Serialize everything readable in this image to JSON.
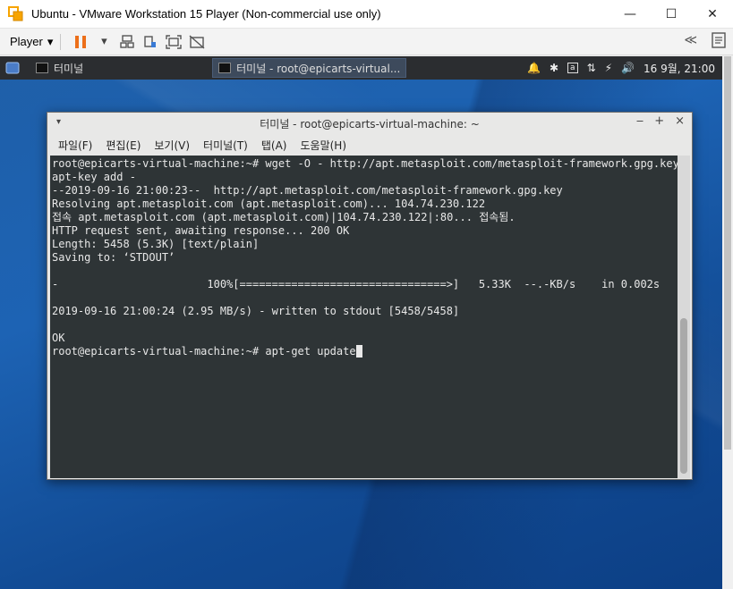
{
  "host": {
    "title": "Ubuntu - VMware Workstation 15 Player (Non-commercial use only)",
    "controls": {
      "minimize": "—",
      "maximize": "☐",
      "close": "✕"
    },
    "toolbar": {
      "player_label": "Player",
      "dropdown_arrow": "▾",
      "collapse_glyph": "≪"
    }
  },
  "guest_panel": {
    "launcher_label": "터미널",
    "active_task_label": "터미널 - root@epicarts-virtual...",
    "tray": {
      "date_time": "16 9월, 21:00"
    }
  },
  "terminal": {
    "title": "터미널 - root@epicarts-virtual-machine: ~",
    "menu": [
      "파일(F)",
      "편집(E)",
      "보기(V)",
      "터미널(T)",
      "탭(A)",
      "도움말(H)"
    ],
    "lines": [
      "root@epicarts-virtual-machine:~# wget -O - http://apt.metasploit.com/metasploit-framework.gpg.key |",
      "apt-key add -",
      "--2019-09-16 21:00:23--  http://apt.metasploit.com/metasploit-framework.gpg.key",
      "Resolving apt.metasploit.com (apt.metasploit.com)... 104.74.230.122",
      "접속 apt.metasploit.com (apt.metasploit.com)|104.74.230.122|:80... 접속됨.",
      "HTTP request sent, awaiting response... 200 OK",
      "Length: 5458 (5.3K) [text/plain]",
      "Saving to: ‘STDOUT’",
      "",
      "-                       100%[================================>]   5.33K  --.-KB/s    in 0.002s",
      "",
      "2019-09-16 21:00:24 (2.95 MB/s) - written to stdout [5458/5458]",
      "",
      "OK"
    ],
    "prompt": "root@epicarts-virtual-machine:~# ",
    "current_input": "apt-get update"
  },
  "colors": {
    "terminal_bg": "#2e3436",
    "terminal_fg": "#e8e8e8",
    "guest_panel_bg": "#2b2d30",
    "desktop_blue": "#1d63b4",
    "pause_orange": "#ec6f1a"
  },
  "icons": {
    "vmware_logo": "vmware-logo-icon",
    "pause": "pause-icon",
    "send_ctrl_alt_del": "network-send-icon",
    "removable_devices": "device-icon",
    "fullscreen": "fullscreen-icon",
    "unity": "unity-icon",
    "message_log": "message-log-icon"
  }
}
